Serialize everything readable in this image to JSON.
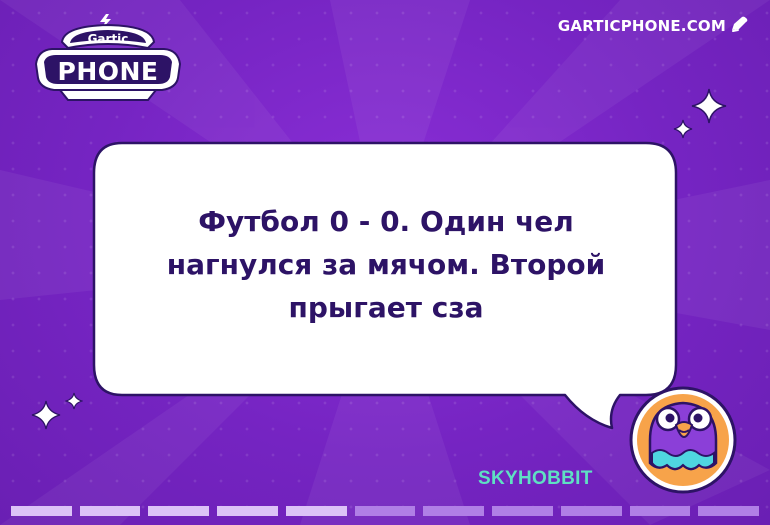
{
  "logo": {
    "top_text": "Gartic",
    "main_text": "PHONE"
  },
  "site_label": "GARTICPHONE.COM",
  "message": {
    "lines": [
      "Футбол 0 - 0. Один чел",
      "нагнулся за мячом. Второй",
      "прыгает сза"
    ]
  },
  "player": {
    "name": "SKYHOBBIT",
    "avatar": "purple-bird-avatar"
  },
  "progress": {
    "total_segments": 11,
    "completed_segments": 5
  },
  "colors": {
    "background": "#7a25c8",
    "bubble": "#ffffff",
    "text": "#2d1366",
    "nickname": "#5fe0c3",
    "segment_done": "#dcc2f7",
    "segment_pending": "#b07fe6"
  },
  "icons": [
    "lightning-icon",
    "edit-pencil-icon",
    "sparkle-icon"
  ]
}
